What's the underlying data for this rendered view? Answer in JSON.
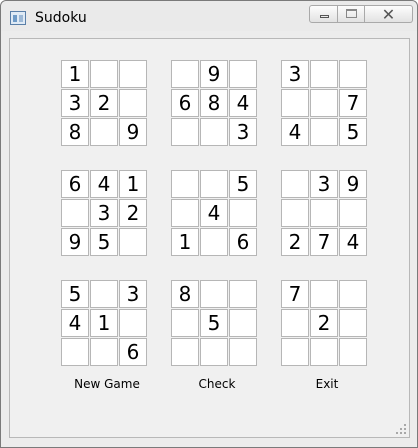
{
  "window": {
    "title": "Sudoku"
  },
  "board": {
    "blocks": [
      {
        "cells": [
          "1",
          "",
          "",
          "3",
          "2",
          "",
          "8",
          "",
          "9"
        ]
      },
      {
        "cells": [
          "",
          "9",
          "",
          "6",
          "8",
          "4",
          "",
          "",
          "3"
        ]
      },
      {
        "cells": [
          "3",
          "",
          "",
          "",
          "",
          "7",
          "4",
          "",
          "5"
        ]
      },
      {
        "cells": [
          "6",
          "4",
          "1",
          "",
          "3",
          "2",
          "9",
          "5",
          ""
        ]
      },
      {
        "cells": [
          "",
          "",
          "5",
          "",
          "4",
          "",
          "1",
          "",
          "6"
        ]
      },
      {
        "cells": [
          "",
          "3",
          "9",
          "",
          "",
          "",
          "2",
          "7",
          "4"
        ]
      },
      {
        "cells": [
          "5",
          "",
          "3",
          "4",
          "1",
          "",
          "",
          "",
          "6"
        ]
      },
      {
        "cells": [
          "8",
          "",
          "",
          "",
          "5",
          "",
          "",
          "",
          ""
        ]
      },
      {
        "cells": [
          "7",
          "",
          "",
          "",
          "2",
          "",
          "",
          "",
          ""
        ]
      }
    ]
  },
  "buttons": {
    "new_game": "New Game",
    "check": "Check",
    "exit": "Exit"
  },
  "icons": {
    "app": "app-icon",
    "minimize": "minimize-icon",
    "maximize": "maximize-icon",
    "close": "close-icon",
    "grip": "size-grip-icon"
  }
}
